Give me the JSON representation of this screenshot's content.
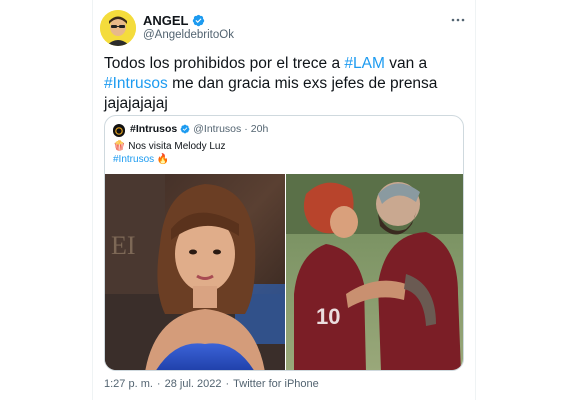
{
  "author": {
    "name": "ANGEL",
    "handle": "@AngeldebritoOk"
  },
  "tweet": {
    "segments": [
      {
        "text": "Todos los prohibidos por el trece a ",
        "hashtag": false
      },
      {
        "text": "#LAM",
        "hashtag": true
      },
      {
        "text": " van a ",
        "hashtag": false
      },
      {
        "text": "#Intrusos",
        "hashtag": true
      },
      {
        "text": " me dan gracia mis exs jefes de prensa jajajajajaj",
        "hashtag": false
      }
    ]
  },
  "quoted": {
    "name": "#Intrusos",
    "handle": "@Intrusos",
    "separator": "·",
    "time": "20h",
    "line1_emoji": "🍿",
    "line1": "Nos visita Melody Luz",
    "line2_hashtag": "#Intrusos",
    "line2_emoji": "🔥"
  },
  "footer": {
    "time": "1:27 p. m.",
    "sep1": "·",
    "date": "28 jul. 2022",
    "sep2": "·",
    "source": "Twitter for iPhone"
  },
  "more_icon": "more-horizontal-icon",
  "colors": {
    "accent": "#1d9bf0",
    "text": "#0f1419",
    "muted": "#536471",
    "border": "#cfd9de"
  }
}
